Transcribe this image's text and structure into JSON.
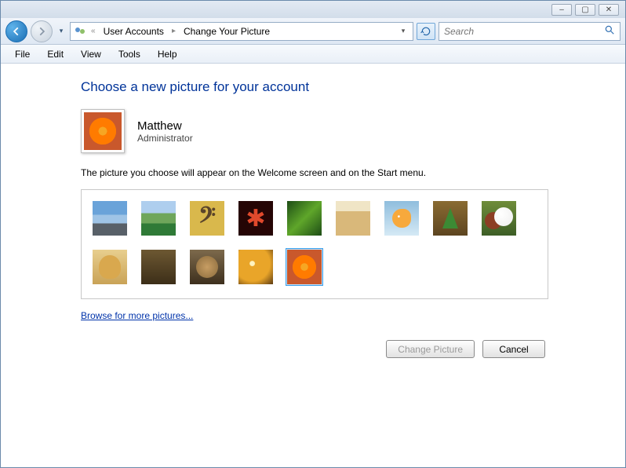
{
  "window_controls": {
    "min": "–",
    "max": "▢",
    "close": "✕"
  },
  "breadcrumb": {
    "level1": "User Accounts",
    "level2": "Change Your Picture"
  },
  "search": {
    "placeholder": "Search"
  },
  "menu": {
    "file": "File",
    "edit": "Edit",
    "view": "View",
    "tools": "Tools",
    "help": "Help"
  },
  "page": {
    "title": "Choose a new picture for your account",
    "user_name": "Matthew",
    "user_role": "Administrator",
    "description": "The picture you choose will appear on the Welcome screen and on the Start menu.",
    "browse": "Browse for more pictures...",
    "change_btn": "Change Picture",
    "cancel_btn": "Cancel"
  },
  "avatars": [
    {
      "name": "rock",
      "class": "rock"
    },
    {
      "name": "golf",
      "class": "golf"
    },
    {
      "name": "clef",
      "class": "clef"
    },
    {
      "name": "star",
      "class": "star"
    },
    {
      "name": "leaf",
      "class": "leaf"
    },
    {
      "name": "robot",
      "class": "robot"
    },
    {
      "name": "fish",
      "class": "fish"
    },
    {
      "name": "pine",
      "class": "pine"
    },
    {
      "name": "balls",
      "class": "balls"
    },
    {
      "name": "dog",
      "class": "dog"
    },
    {
      "name": "chess",
      "class": "chess"
    },
    {
      "name": "cat",
      "class": "cat"
    },
    {
      "name": "sparkle",
      "class": "sparkle"
    },
    {
      "name": "flower",
      "class": "flower",
      "selected": true
    }
  ],
  "clef_glyph": "𝄢",
  "star_glyph": "✱"
}
